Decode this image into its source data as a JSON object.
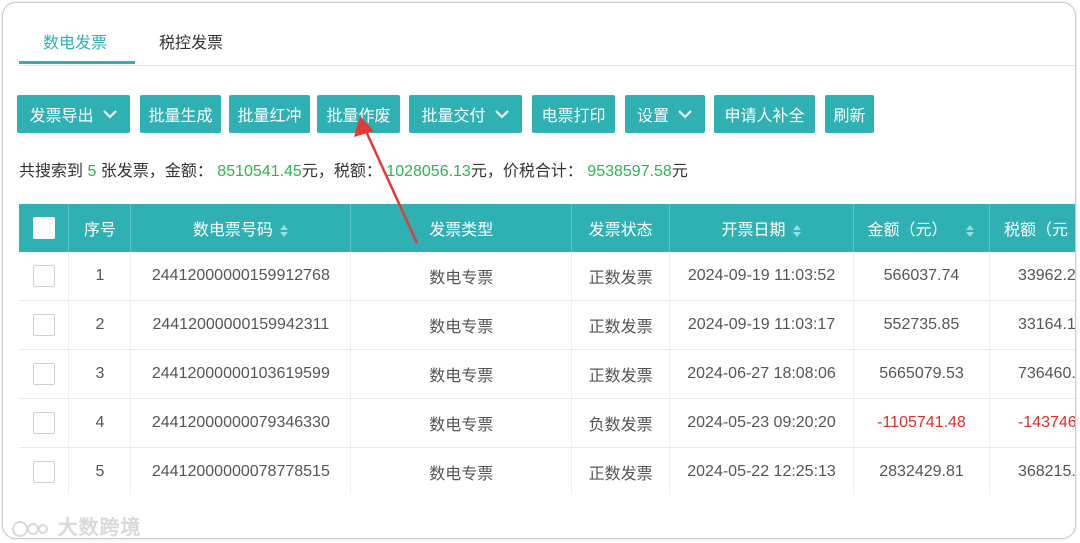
{
  "tabs": [
    {
      "label": "数电发票"
    },
    {
      "label": "税控发票"
    }
  ],
  "toolbar": {
    "export_label": "发票导出",
    "batch_generate_label": "批量生成",
    "batch_red_label": "批量红冲",
    "batch_void_label": "批量作废",
    "batch_deliver_label": "批量交付",
    "print_label": "电票打印",
    "settings_label": "设置",
    "applicant_fill_label": "申请人补全",
    "refresh_label": "刷新"
  },
  "summary": {
    "prefix": "共搜索到",
    "count": "5",
    "count_suffix": "张发票，金额：",
    "amount": "8510541.45",
    "amount_suffix": "元，税额：",
    "tax": "1028056.13",
    "tax_suffix": "元，价税合计：",
    "total": "9538597.58",
    "total_suffix": "元"
  },
  "table": {
    "headers": [
      "序号",
      "数电票号码",
      "发票类型",
      "发票状态",
      "开票日期",
      "金额（元）",
      "税额（元"
    ],
    "rows": [
      {
        "no": "1",
        "invoice_no": "24412000000159912768",
        "type": "数电专票",
        "status": "正数发票",
        "date": "2024-09-19 11:03:52",
        "amount": "566037.74",
        "tax": "33962.2"
      },
      {
        "no": "2",
        "invoice_no": "24412000000159942311",
        "type": "数电专票",
        "status": "正数发票",
        "date": "2024-09-19 11:03:17",
        "amount": "552735.85",
        "tax": "33164.1"
      },
      {
        "no": "3",
        "invoice_no": "24412000000103619599",
        "type": "数电专票",
        "status": "正数发票",
        "date": "2024-06-27 18:08:06",
        "amount": "5665079.53",
        "tax": "736460."
      },
      {
        "no": "4",
        "invoice_no": "24412000000079346330",
        "type": "数电专票",
        "status": "负数发票",
        "date": "2024-05-23 09:20:20",
        "amount": "-1105741.48",
        "tax": "-143746"
      },
      {
        "no": "5",
        "invoice_no": "24412000000078778515",
        "type": "数电专票",
        "status": "正数发票",
        "date": "2024-05-22 12:25:13",
        "amount": "2832429.81",
        "tax": "368215."
      }
    ]
  },
  "watermark": "大数跨境",
  "colors": {
    "accent": "#2fb1b3",
    "positive_number": "#2eb34e",
    "negative": "#e02c2c",
    "annotation_arrow": "#e53935"
  },
  "icons": {
    "dropdown": "chevron-down-icon",
    "sort": "sort-icon",
    "arrow": "annotation-arrow"
  }
}
